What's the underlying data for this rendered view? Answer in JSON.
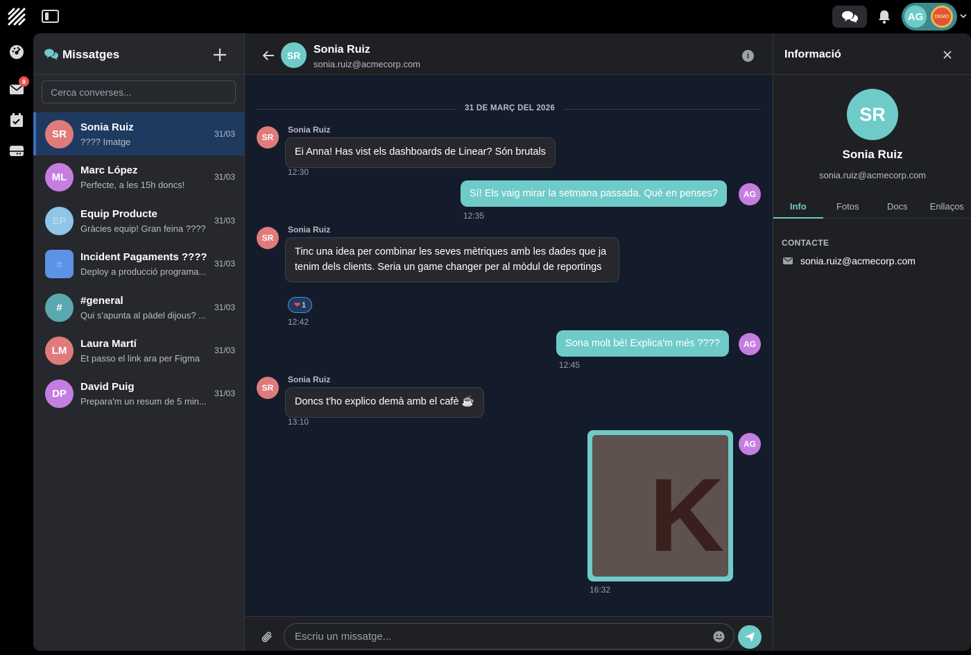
{
  "topbar": {
    "user_initials": "AG",
    "demo_badge": "DEMO"
  },
  "nav": {
    "mail_badge": "8"
  },
  "conversations": {
    "title": "Missatges",
    "search_placeholder": "Cerca converses...",
    "items": [
      {
        "initials": "SR",
        "name": "Sonia Ruiz",
        "preview": "???? Imatge",
        "date": "31/03",
        "color": "#e07b7b"
      },
      {
        "initials": "ML",
        "name": "Marc López",
        "preview": "Perfecte, a les 15h doncs!",
        "date": "31/03",
        "color": "#c57ee0"
      },
      {
        "initials": "EP",
        "name": "Equip Producte",
        "preview": "Gràcies equip! Gran feina ????",
        "date": "31/03",
        "color": "#8fc5e8"
      },
      {
        "initials": "",
        "name": "Incident Pagaments ????",
        "preview": "Deploy a producció programa...",
        "date": "31/03",
        "color": "#5c93e6"
      },
      {
        "initials": "#",
        "name": "#general",
        "preview": "Qui s'apunta al pàdel dijous? ...",
        "date": "31/03",
        "color": "#5aa8b0"
      },
      {
        "initials": "LM",
        "name": "Laura Martí",
        "preview": "Et passo el link ara per Figma",
        "date": "31/03",
        "color": "#e07b7b"
      },
      {
        "initials": "DP",
        "name": "David Puig",
        "preview": "Prepara'm un resum de 5 min...",
        "date": "31/03",
        "color": "#c57ee0"
      }
    ]
  },
  "chat": {
    "contact_initials": "SR",
    "contact_name": "Sonia Ruiz",
    "contact_email": "sonia.ruiz@acmecorp.com",
    "day_label": "31 DE MARÇ DEL 2026",
    "messages": [
      {
        "sender": "Sonia Ruiz",
        "text": "Ei Anna! Has vist els dashboards de Linear? Són brutals",
        "time": "12:30"
      },
      {
        "sender": "AG",
        "text": "Sí! Els vaig mirar la setmana passada. Què en penses?",
        "time": "12:35"
      },
      {
        "sender": "Sonia Ruiz",
        "text": "Tinc una idea per combinar les seves mètriques amb les dades que ja tenim dels clients. Seria un game changer per al mòdul de reportings",
        "time": "12:42",
        "reaction_count": "1"
      },
      {
        "sender": "AG",
        "text": "Sona molt bé! Explica'm més ????",
        "time": "12:45"
      },
      {
        "sender": "Sonia Ruiz",
        "text": "Doncs t'ho explico demà amb el cafè ☕",
        "time": "13:10"
      },
      {
        "sender": "AG",
        "image_letter": "K",
        "time": "16:32"
      }
    ],
    "composer_placeholder": "Escriu un missatge..."
  },
  "info_panel": {
    "title": "Informació",
    "initials": "SR",
    "name": "Sonia Ruiz",
    "email": "sonia.ruiz@acmecorp.com",
    "tabs": [
      "Info",
      "Fotos",
      "Docs",
      "Enllaços"
    ],
    "section_label": "CONTACTE",
    "contact_email": "sonia.ruiz@acmecorp.com"
  },
  "colors": {
    "accent": "#6fcbc8",
    "active_conv": "#1f3a60",
    "badge": "#e8514a"
  }
}
